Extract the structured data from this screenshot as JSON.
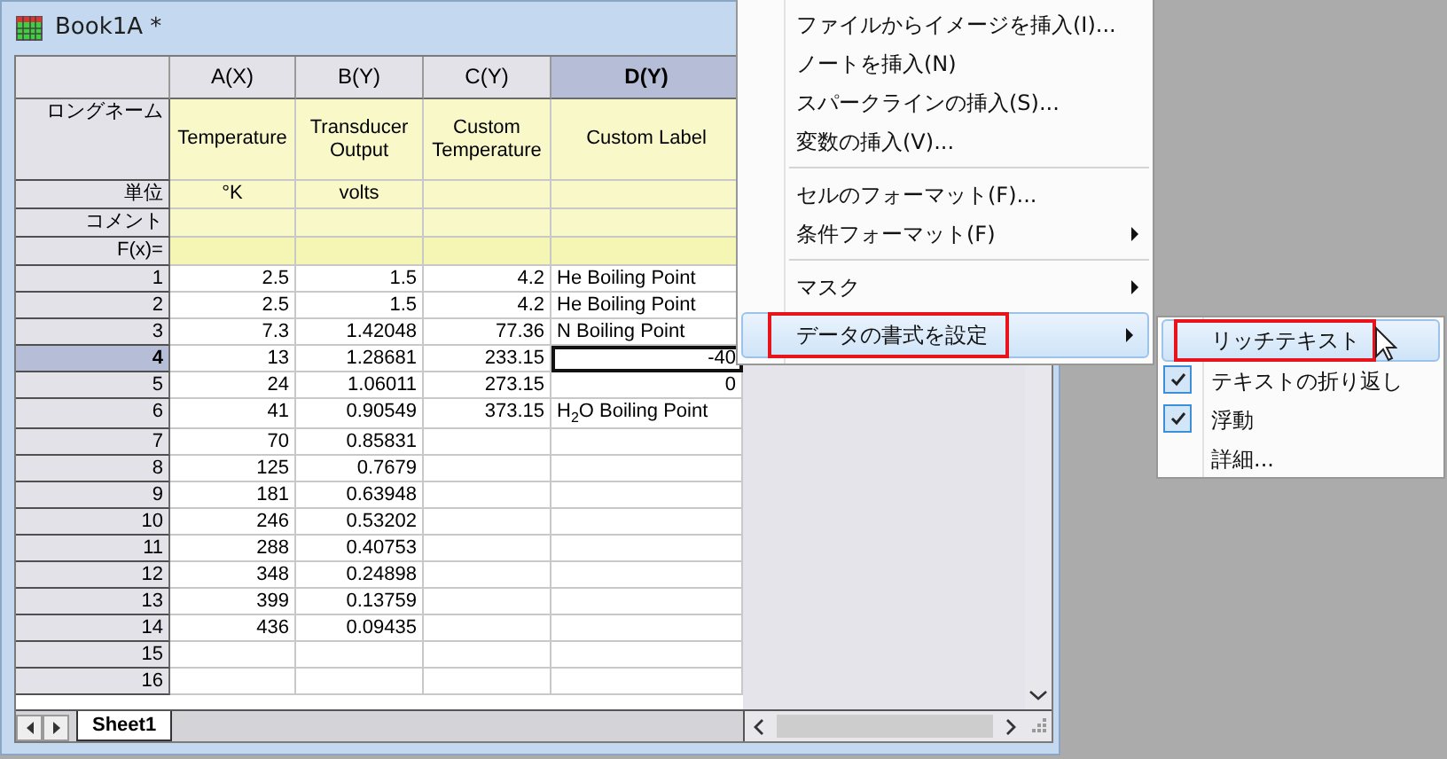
{
  "window": {
    "title": "Book1A *"
  },
  "columns": [
    {
      "label": "A(X)",
      "selected": false,
      "long_name": "Temperature",
      "units": "°K"
    },
    {
      "label": "B(Y)",
      "selected": false,
      "long_name": "Transducer Output",
      "units": "volts"
    },
    {
      "label": "C(Y)",
      "selected": false,
      "long_name": "Custom Temperature"
    },
    {
      "label": "D(Y)",
      "selected": true,
      "long_name": "Custom Label"
    }
  ],
  "label_rows": [
    {
      "label": "ロングネーム",
      "kind": "long_name"
    },
    {
      "label": "単位",
      "kind": "units"
    },
    {
      "label": "コメント",
      "kind": "comments"
    },
    {
      "label": "F(x)=",
      "kind": "formula"
    }
  ],
  "rows": [
    {
      "header": "1",
      "selected": false,
      "cells": [
        "2.5",
        "1.5",
        "4.2"
      ],
      "d": {
        "text": "He Boiling Point",
        "kind": "text"
      }
    },
    {
      "header": "2",
      "selected": false,
      "cells": [
        "2.5",
        "1.5",
        "4.2"
      ],
      "d": {
        "text": "He Boiling Point",
        "kind": "text"
      }
    },
    {
      "header": "3",
      "selected": false,
      "cells": [
        "7.3",
        "1.42048",
        "77.36"
      ],
      "d": {
        "text": "N Boiling Point",
        "kind": "text"
      }
    },
    {
      "header": "4",
      "selected": true,
      "cells": [
        "13",
        "1.28681",
        "233.15"
      ],
      "d": {
        "text": "-40",
        "kind": "number"
      }
    },
    {
      "header": "5",
      "selected": false,
      "cells": [
        "24",
        "1.06011",
        "273.15"
      ],
      "d": {
        "text": "0",
        "kind": "number"
      }
    },
    {
      "header": "6",
      "selected": false,
      "cells": [
        "41",
        "0.90549",
        "373.15"
      ],
      "d": {
        "text": "H$_{2}$O Boiling Point",
        "kind": "text"
      }
    },
    {
      "header": "7",
      "selected": false,
      "cells": [
        "70",
        "0.85831"
      ]
    },
    {
      "header": "8",
      "selected": false,
      "cells": [
        "125",
        "0.7679"
      ]
    },
    {
      "header": "9",
      "selected": false,
      "cells": [
        "181",
        "0.63948"
      ]
    },
    {
      "header": "10",
      "selected": false,
      "cells": [
        "246",
        "0.53202"
      ]
    },
    {
      "header": "11",
      "selected": false,
      "cells": [
        "288",
        "0.40753"
      ]
    },
    {
      "header": "12",
      "selected": false,
      "cells": [
        "348",
        "0.24898"
      ]
    },
    {
      "header": "13",
      "selected": false,
      "cells": [
        "399",
        "0.13759"
      ]
    },
    {
      "header": "14",
      "selected": false,
      "cells": [
        "436",
        "0.09435"
      ]
    },
    {
      "header": "15",
      "selected": false
    },
    {
      "header": "16",
      "selected": false
    }
  ],
  "sheet_tabs": [
    {
      "label": "Sheet1",
      "selected": true
    }
  ],
  "menu": {
    "items": [
      {
        "kind": "item",
        "label": "ファイルからイメージを挿入(I)...",
        "submenu": false,
        "selected": false,
        "annotated": false
      },
      {
        "kind": "item",
        "label": "ノートを挿入(N)",
        "submenu": false,
        "selected": false,
        "annotated": false
      },
      {
        "kind": "item",
        "label": "スパークラインの挿入(S)...",
        "submenu": false,
        "selected": false,
        "annotated": false
      },
      {
        "kind": "item",
        "label": "変数の挿入(V)...",
        "submenu": false,
        "selected": false,
        "annotated": false
      },
      {
        "kind": "separator"
      },
      {
        "kind": "item",
        "label": "セルのフォーマット(F)...",
        "submenu": false,
        "selected": false,
        "annotated": false
      },
      {
        "kind": "item",
        "label": "条件フォーマット(F)",
        "submenu": true,
        "selected": false,
        "annotated": false
      },
      {
        "kind": "separator"
      },
      {
        "kind": "item",
        "label": "マスク",
        "submenu": true,
        "selected": false,
        "annotated": false
      },
      {
        "kind": "item",
        "label": "データの書式を設定",
        "submenu": true,
        "selected": true,
        "annotated": true
      }
    ]
  },
  "submenu": {
    "items": [
      {
        "label": "リッチテキスト",
        "checked": false,
        "selected": true,
        "annotated": true
      },
      {
        "label": "テキストの折り返し",
        "checked": true,
        "selected": false,
        "annotated": false
      },
      {
        "label": "浮動",
        "checked": true,
        "selected": false,
        "annotated": false
      },
      {
        "label": "詳細...",
        "checked": false,
        "selected": false,
        "annotated": false
      }
    ]
  }
}
